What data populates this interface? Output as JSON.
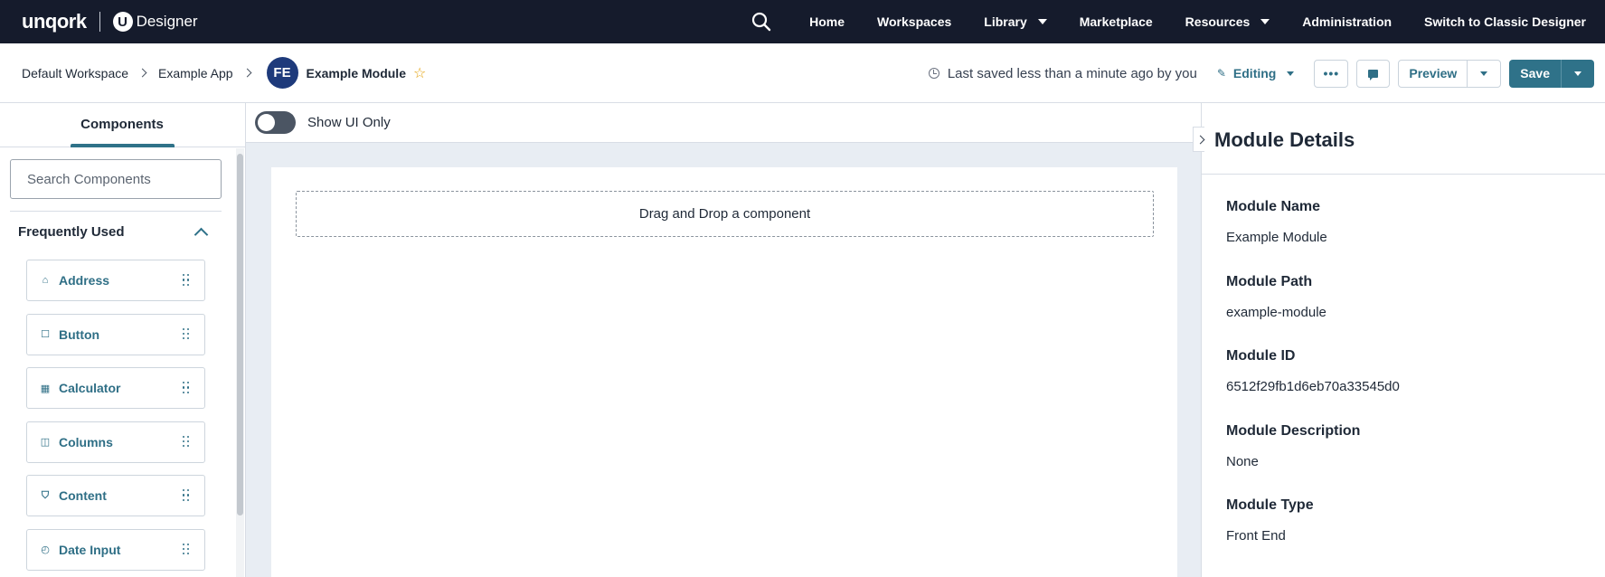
{
  "topnav": {
    "brand": "unqork",
    "brand_u": "U",
    "product": "Designer",
    "items": [
      {
        "label": "Home"
      },
      {
        "label": "Workspaces"
      },
      {
        "label": "Library"
      },
      {
        "label": "Marketplace"
      },
      {
        "label": "Resources"
      },
      {
        "label": "Administration"
      },
      {
        "label": "Switch to Classic Designer"
      }
    ]
  },
  "breadcrumb": {
    "items": [
      "Default Workspace",
      "Example App"
    ],
    "avatar_initials": "FE",
    "current": "Example Module"
  },
  "toolbar": {
    "saved_status": "Last saved less than a minute ago by you",
    "mode": "Editing",
    "more": "•••",
    "preview": "Preview",
    "save": "Save"
  },
  "left_panel": {
    "tab": "Components",
    "search_placeholder": "Search Components",
    "section": "Frequently Used",
    "components": [
      {
        "label": "Address",
        "icon": "home-icon",
        "glyph": "⌂"
      },
      {
        "label": "Button",
        "icon": "square-icon",
        "glyph": "☐"
      },
      {
        "label": "Calculator",
        "icon": "calculator-icon",
        "glyph": "▦"
      },
      {
        "label": "Columns",
        "icon": "columns-icon",
        "glyph": "◫"
      },
      {
        "label": "Content",
        "icon": "html5-icon",
        "glyph": "⛉"
      },
      {
        "label": "Date Input",
        "icon": "clock-icon",
        "glyph": "◴"
      }
    ]
  },
  "canvas": {
    "toggle_label": "Show UI Only",
    "toggle_on": false,
    "dropzone": "Drag and Drop a component"
  },
  "right_panel": {
    "title": "Module Details",
    "details": [
      {
        "label": "Module Name",
        "value": "Example Module"
      },
      {
        "label": "Module Path",
        "value": "example-module"
      },
      {
        "label": "Module ID",
        "value": "6512f29fb1d6eb70a33545d0"
      },
      {
        "label": "Module Description",
        "value": "None"
      },
      {
        "label": "Module Type",
        "value": "Front End"
      }
    ]
  },
  "colors": {
    "nav_bg": "#151b2c",
    "accent": "#2f7289",
    "canvas_bg": "#e8edf3"
  }
}
